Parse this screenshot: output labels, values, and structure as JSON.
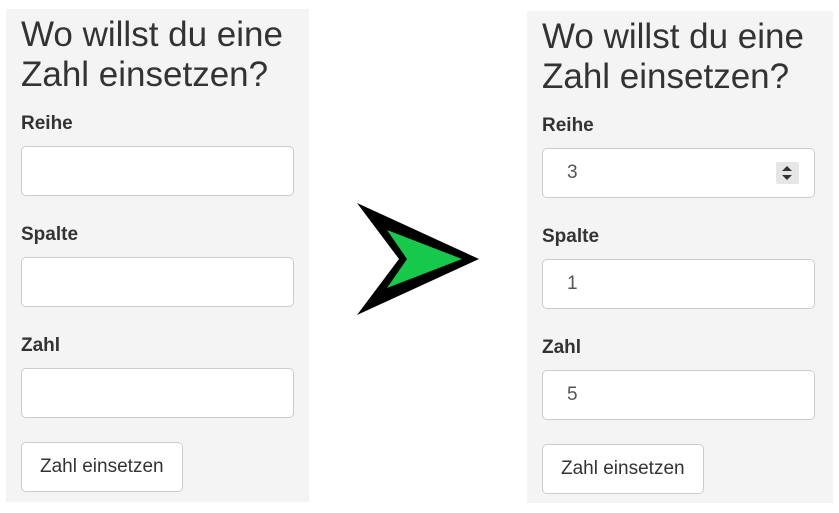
{
  "before": {
    "heading": "Wo willst du eine Zahl einsetzen?",
    "row_label": "Reihe",
    "row_value": "",
    "column_label": "Spalte",
    "column_value": "",
    "number_label": "Zahl",
    "number_value": "",
    "submit_label": "Zahl einsetzen"
  },
  "after": {
    "heading": "Wo willst du eine Zahl einsetzen?",
    "row_label": "Reihe",
    "row_value": "3",
    "column_label": "Spalte",
    "column_value": "1",
    "number_label": "Zahl",
    "number_value": "5",
    "submit_label": "Zahl einsetzen"
  },
  "arrow": {
    "icon": "arrow-right-icon",
    "fill_color": "#16c94a",
    "outline_color": "#000000"
  },
  "colors": {
    "panel_background": "#f4f4f4",
    "field_border": "#cccccc",
    "text": "#333333"
  }
}
